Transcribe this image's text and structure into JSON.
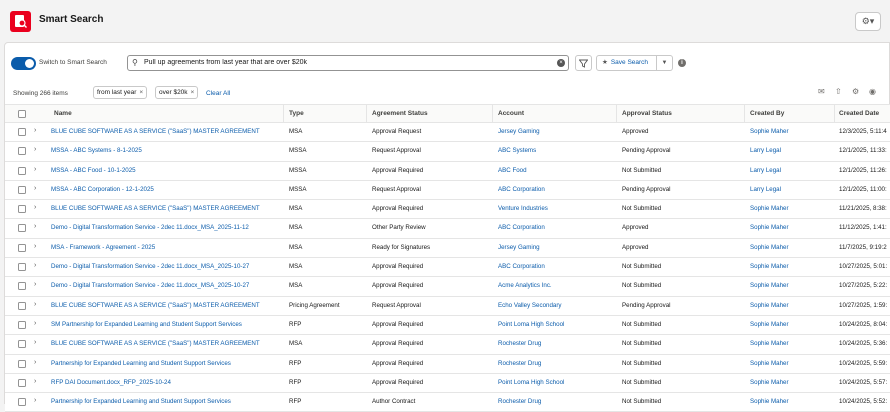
{
  "header": {
    "title": "Smart Search",
    "settings_label": "⚙▾"
  },
  "toolbar": {
    "toggle_label": "Switch to Smart Search",
    "search_value": "Pull up agreements from last year that are over $20k",
    "save_search_label": "Save Search"
  },
  "filters": {
    "showing": "Showing 266 items",
    "pills": [
      "from last year",
      "over $20k"
    ],
    "clear_all": "Clear All"
  },
  "table": {
    "headers": [
      "Name",
      "Type",
      "Agreement Status",
      "Account",
      "Approval Status",
      "Created By",
      "Created Date"
    ],
    "rows": [
      {
        "name": "BLUE CUBE SOFTWARE AS A SERVICE (\"SaaS\") MASTER AGREEMENT",
        "type": "MSA",
        "status": "Approval Request",
        "account": "Jersey Gaming",
        "approval": "Approved",
        "created_by": "Sophie Maher",
        "created_date": "12/3/2025, 5:11:4"
      },
      {
        "name": "MSSA - ABC Systems - 8-1-2025",
        "type": "MSSA",
        "status": "Request Approval",
        "account": "ABC Systems",
        "approval": "Pending Approval",
        "created_by": "Larry Legal",
        "created_date": "12/1/2025, 11:33:"
      },
      {
        "name": "MSSA - ABC Food - 10-1-2025",
        "type": "MSSA",
        "status": "Approval Required",
        "account": "ABC Food",
        "approval": "Not Submitted",
        "created_by": "Larry Legal",
        "created_date": "12/1/2025, 11:26:"
      },
      {
        "name": "MSSA - ABC Corporation - 12-1-2025",
        "type": "MSSA",
        "status": "Request Approval",
        "account": "ABC Corporation",
        "approval": "Pending Approval",
        "created_by": "Larry Legal",
        "created_date": "12/1/2025, 11:00:"
      },
      {
        "name": "BLUE CUBE SOFTWARE AS A SERVICE (\"SaaS\") MASTER AGREEMENT",
        "type": "MSA",
        "status": "Approval Required",
        "account": "Venture Industries",
        "approval": "Not Submitted",
        "created_by": "Sophie Maher",
        "created_date": "11/21/2025, 8:38:"
      },
      {
        "name": "Demo - Digital Transformation Service - 2dec 11.docx_MSA_2025-11-12",
        "type": "MSA",
        "status": "Other Party Review",
        "account": "ABC Corporation",
        "approval": "Approved",
        "created_by": "Sophie Maher",
        "created_date": "11/12/2025, 1:41:"
      },
      {
        "name": "MSA - Framework - Agreement - 2025",
        "type": "MSA",
        "status": "Ready for Signatures",
        "account": "Jersey Gaming",
        "approval": "Approved",
        "created_by": "Sophie Maher",
        "created_date": "11/7/2025, 9:19:2"
      },
      {
        "name": "Demo - Digital Transformation Service - 2dec 11.docx_MSA_2025-10-27",
        "type": "MSA",
        "status": "Approval Required",
        "account": "ABC Corporation",
        "approval": "Not Submitted",
        "created_by": "Sophie Maher",
        "created_date": "10/27/2025, 5:01:"
      },
      {
        "name": "Demo - Digital Transformation Service - 2dec 11.docx_MSA_2025-10-27",
        "type": "MSA",
        "status": "Approval Required",
        "account": "Acme Analytics Inc.",
        "approval": "Not Submitted",
        "created_by": "Sophie Maher",
        "created_date": "10/27/2025, 5:22:"
      },
      {
        "name": "BLUE CUBE SOFTWARE AS A SERVICE (\"SaaS\") MASTER AGREEMENT",
        "type": "Pricing Agreement",
        "status": "Request Approval",
        "account": "Echo Valley Secondary",
        "approval": "Pending Approval",
        "created_by": "Sophie Maher",
        "created_date": "10/27/2025, 1:59:"
      },
      {
        "name": "SM Partnership for Expanded Learning and Student Support Services",
        "type": "RFP",
        "status": "Approval Required",
        "account": "Point Loma High School",
        "approval": "Not Submitted",
        "created_by": "Sophie Maher",
        "created_date": "10/24/2025, 8:04:"
      },
      {
        "name": "BLUE CUBE SOFTWARE AS A SERVICE (\"SaaS\") MASTER AGREEMENT",
        "type": "MSA",
        "status": "Approval Required",
        "account": "Rochester Drug",
        "approval": "Not Submitted",
        "created_by": "Sophie Maher",
        "created_date": "10/24/2025, 5:36:"
      },
      {
        "name": "Partnership for Expanded Learning and Student Support Services",
        "type": "RFP",
        "status": "Approval Required",
        "account": "Rochester Drug",
        "approval": "Not Submitted",
        "created_by": "Sophie Maher",
        "created_date": "10/24/2025, 5:59:"
      },
      {
        "name": "RFP DAI Document.docx_RFP_2025-10-24",
        "type": "RFP",
        "status": "Approval Required",
        "account": "Point Loma High School",
        "approval": "Not Submitted",
        "created_by": "Sophie Maher",
        "created_date": "10/24/2025, 5:57:"
      },
      {
        "name": "Partnership for Expanded Learning and Student Support Services",
        "type": "RFP",
        "status": "Author Contract",
        "account": "Rochester Drug",
        "approval": "Not Submitted",
        "created_by": "Sophie Maher",
        "created_date": "10/24/2025, 5:52:"
      }
    ]
  }
}
